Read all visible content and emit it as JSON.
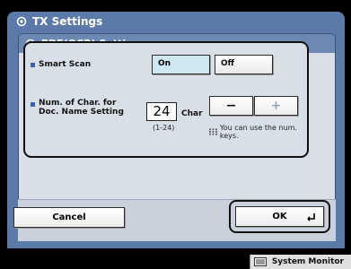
{
  "window": {
    "outer_title": "TX Settings",
    "inner_title": "PDF(OCR) Settings"
  },
  "smart_scan": {
    "label": "Smart Scan",
    "options": [
      "On",
      "Off"
    ],
    "selected": "On"
  },
  "doc_name": {
    "label_line1": "Num. of Char. for",
    "label_line2": "Doc. Name Setting",
    "value": "24",
    "unit": "Char",
    "range": "(1-24)",
    "minus": "−",
    "plus": "+",
    "hint": "You can use the num. keys."
  },
  "footer": {
    "cancel": "Cancel",
    "ok": "OK",
    "system_monitor": "System Monitor"
  },
  "icons": {
    "title_icon": "settings-icon",
    "keypad_icon": "keypad-icon",
    "enter_icon": "enter-icon",
    "monitor_icon": "monitor-icon"
  },
  "colors": {
    "outer_panel": "#5c7aa8",
    "inner_header": "#6d88b3",
    "panel_bg": "#d9dfe6",
    "selected_button": "#cfe7f1",
    "bullet": "#3f64a5"
  }
}
